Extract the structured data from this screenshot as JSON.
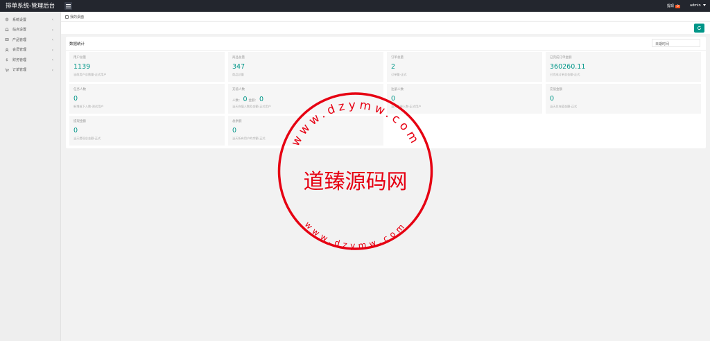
{
  "header": {
    "app_title": "排单系统-管理后台",
    "notify_label": "提现",
    "notify_badge": "0",
    "user_name": "admin"
  },
  "sidebar": {
    "items": [
      {
        "label": "系统设置",
        "icon": "gear-icon"
      },
      {
        "label": "站点设置",
        "icon": "bell-icon"
      },
      {
        "label": "产品管理",
        "icon": "box-icon"
      },
      {
        "label": "会员管理",
        "icon": "user-icon"
      },
      {
        "label": "财务管理",
        "icon": "dollar-icon"
      },
      {
        "label": "订单管理",
        "icon": "cart-icon"
      }
    ]
  },
  "breadcrumb": {
    "label": "我的桌面"
  },
  "panel": {
    "title": "数据统计",
    "time_placeholder": "日期时间"
  },
  "cards": [
    {
      "label": "用户总量",
      "value": "1139",
      "sub": "当前用户总数量-正式用户"
    },
    {
      "label": "商品总量",
      "value": "347",
      "sub": "商品总量"
    },
    {
      "label": "订单总量",
      "value": "2",
      "sub": "订单量-正式"
    },
    {
      "label": "已完成订单金额",
      "value": "360260.11",
      "sub": "已完成订单总金额-正式"
    },
    {
      "label": "任务人数",
      "value": "0",
      "sub": "新增或下入数-测试用户"
    },
    {
      "label": "充值人数",
      "people_label": "人数：",
      "people_value": "0",
      "amount_label": "金额：",
      "amount_value": "0",
      "sub": "当天充值人数及金额-正式用户"
    },
    {
      "label": "注册人数",
      "value": "0",
      "sub": "当天注册人数-正式用户"
    },
    {
      "label": "充值金额",
      "value": "0",
      "sub": "当天总充值金额-正式"
    },
    {
      "label": "提现金额",
      "value": "0",
      "sub": "当天提现总金额-正式"
    },
    {
      "label": "总余额",
      "value": "0",
      "sub": "当天所有用户的余额-正式"
    }
  ],
  "watermark": {
    "center_text": "道臻源码网",
    "top_arc": "www.dzymw.com",
    "bottom_arc": "www.dzymw.com",
    "color": "#e60012"
  },
  "colors": {
    "accent": "#009688",
    "header_bg": "#23262e",
    "badge": "#ff5722"
  }
}
